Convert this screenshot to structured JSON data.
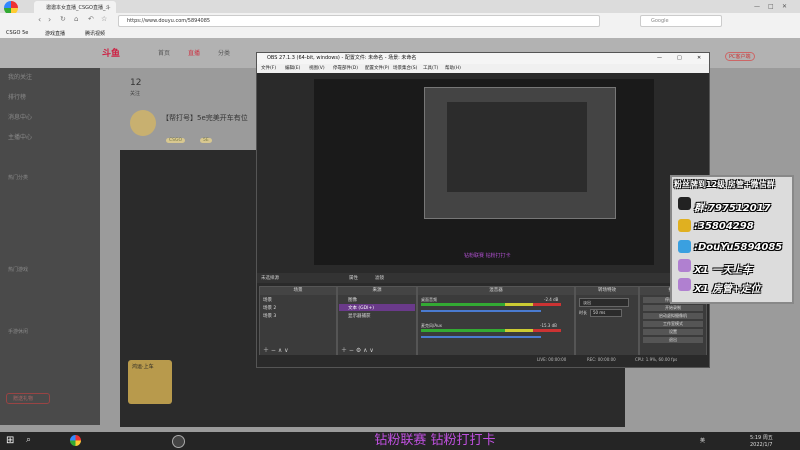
{
  "browser": {
    "tab_title": "邀邀本女直播_CSGO直播_斗",
    "url": "https://www.douyu.com/5894085",
    "search_placeholder": "Google",
    "bookmarks": [
      "CSGO 5e",
      "游戏直播",
      "腾讯视频"
    ]
  },
  "site": {
    "logo": "斗鱼",
    "nav": [
      "首页",
      "直播",
      "分类"
    ],
    "stats": [
      {
        "value": "12",
        "label": "关注"
      }
    ],
    "room_title": "【帮打号】5e完美开车有位",
    "tags": [
      "CSGO",
      "5E"
    ],
    "pc_badge": "PC客户端",
    "left_menu": [
      "我的关注",
      "排行榜",
      "消息中心",
      "主播中心"
    ],
    "left_section_titles": [
      "热门分类",
      "热门游戏",
      "手游休闲"
    ],
    "promo_button": "赠送礼物",
    "gift_card": "鸿运·上车"
  },
  "obs": {
    "title": "OBS 27.1.3 (64-bit, windows) - 配置文件: 未命名 - 场景: 未命名",
    "menu": [
      "文件(F)",
      "编辑(E)",
      "视图(V)",
      "停靠部件(D)",
      "配置文件(P)",
      "场景集合(S)",
      "工具(T)",
      "帮助(H)"
    ],
    "source_label": "未选择源",
    "props_button": "属性",
    "filters_button": "滤镜",
    "docks": {
      "scenes": "场景",
      "sources": "来源",
      "mixer": "混音器",
      "transitions": "转场特效",
      "controls": "控件"
    },
    "scenes": [
      "场景",
      "场景 2",
      "场景 3"
    ],
    "sources": [
      "图像",
      "文本 (GDI+)",
      "显示器捕获"
    ],
    "mixer": [
      {
        "name": "桌面音频",
        "level": "-2.4 dB"
      },
      {
        "name": "麦克风/Aux",
        "level": "-15.3 dB"
      }
    ],
    "transition": {
      "type": "淡出",
      "duration_label": "时长",
      "duration": "50 ms"
    },
    "controls": [
      "停止推流",
      "开始录制",
      "启动虚拟摄像机",
      "工作室模式",
      "设置",
      "退出"
    ],
    "status": {
      "live": "LIVE: 00:00:00",
      "rec": "REC: 00:00:00",
      "cpu": "CPU: 1.9%, 60.00 fps"
    },
    "preview_caption": "钻粉联赛 钻粉打打卡"
  },
  "overlay": {
    "title": "粉丝牌到12级 房管+微信群",
    "rows": [
      "群:797512017",
      ":35804298",
      ":DouYu5894085",
      "X1 一天上车",
      "X1 房管+定位"
    ]
  },
  "footer_banner": "钻粉联赛 钻粉打打卡",
  "taskbar": {
    "time": "5:19 周五",
    "date": "2022/1/7",
    "lang": "英"
  }
}
